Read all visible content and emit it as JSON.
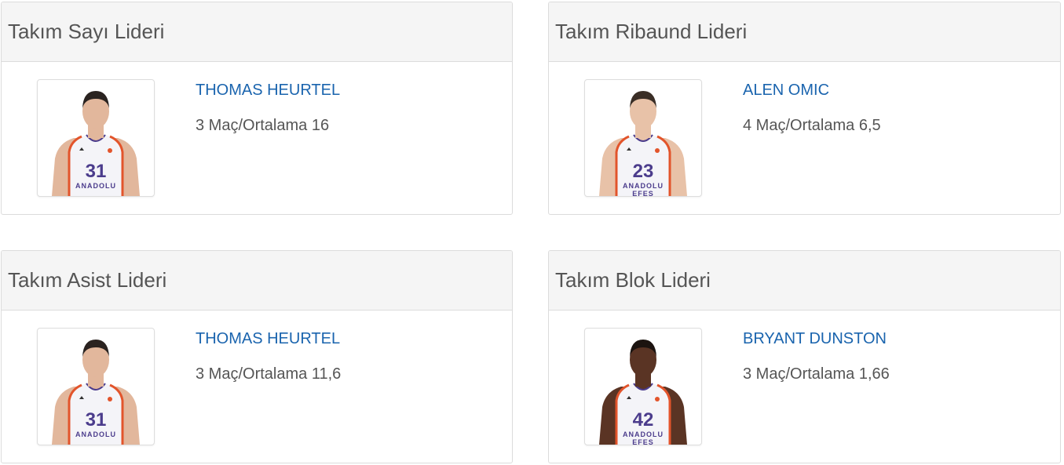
{
  "panels": [
    {
      "title": "Takım Sayı Lideri",
      "player": {
        "name": "THOMAS HEURTEL",
        "jersey": "31",
        "team_text": "ANADOLU",
        "skin": "#e2b79c",
        "hair": "#2a2320"
      },
      "stat": "3 Maç/Ortalama 16"
    },
    {
      "title": "Takım Ribaund Lideri",
      "player": {
        "name": "ALEN OMIC",
        "jersey": "23",
        "team_text": "ANADOLU EFES",
        "skin": "#e8c2a8",
        "hair": "#3a2e26"
      },
      "stat": "4 Maç/Ortalama 6,5"
    },
    {
      "title": "Takım Asist Lideri",
      "player": {
        "name": "THOMAS HEURTEL",
        "jersey": "31",
        "team_text": "ANADOLU",
        "skin": "#e2b79c",
        "hair": "#2a2320"
      },
      "stat": "3 Maç/Ortalama 11,6"
    },
    {
      "title": "Takım Blok Lideri",
      "player": {
        "name": "BRYANT DUNSTON",
        "jersey": "42",
        "team_text": "ANADOLU EFES",
        "skin": "#5a3424",
        "hair": "#1c1410"
      },
      "stat": "3 Maç/Ortalama 1,66"
    }
  ],
  "colors": {
    "link": "#1a64ae",
    "jersey_number": "#4b3c8c",
    "jersey_trim": "#e2542b"
  }
}
